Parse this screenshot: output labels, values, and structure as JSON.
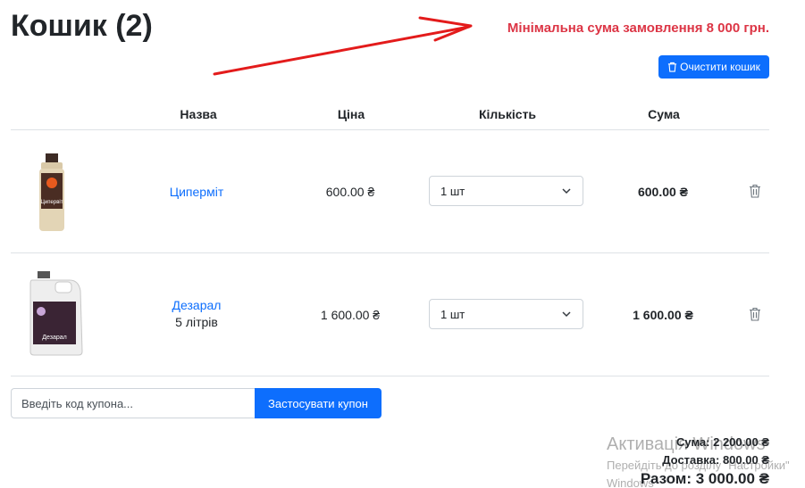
{
  "header": {
    "title": "Кошик (2)",
    "min_order": "Мінімальна сума замовлення 8 000 грн.",
    "clear_label": "Очистити кошик"
  },
  "table": {
    "columns": [
      "Назва",
      "Ціна",
      "Кількість",
      "Сума"
    ],
    "rows": [
      {
        "name": "Циперміт",
        "variant": "",
        "price": "600.00 ₴",
        "qty": "1 шт",
        "sum": "600.00 ₴",
        "image_label": "Ципервіт"
      },
      {
        "name": "Дезарал",
        "variant": "5 літрів",
        "price": "1 600.00 ₴",
        "qty": "1 шт",
        "sum": "1 600.00 ₴",
        "image_label": "Дезарал"
      }
    ]
  },
  "coupon": {
    "placeholder": "Введіть код купона...",
    "apply_label": "Застосувати купон"
  },
  "totals": {
    "subtotal": "Сума: 2 200.00 ₴",
    "delivery": "Доставка: 800.00 ₴",
    "total": "Разом: 3 000.00 ₴"
  },
  "watermark": {
    "title": "Активація Windows",
    "subtitle": "Перейдіть до розділу \"Настройки\"",
    "subtitle2": "Windows"
  },
  "colors": {
    "primary": "#0d6efd",
    "alert": "#dc3545",
    "annotation_arrow": "#e31b1b"
  }
}
